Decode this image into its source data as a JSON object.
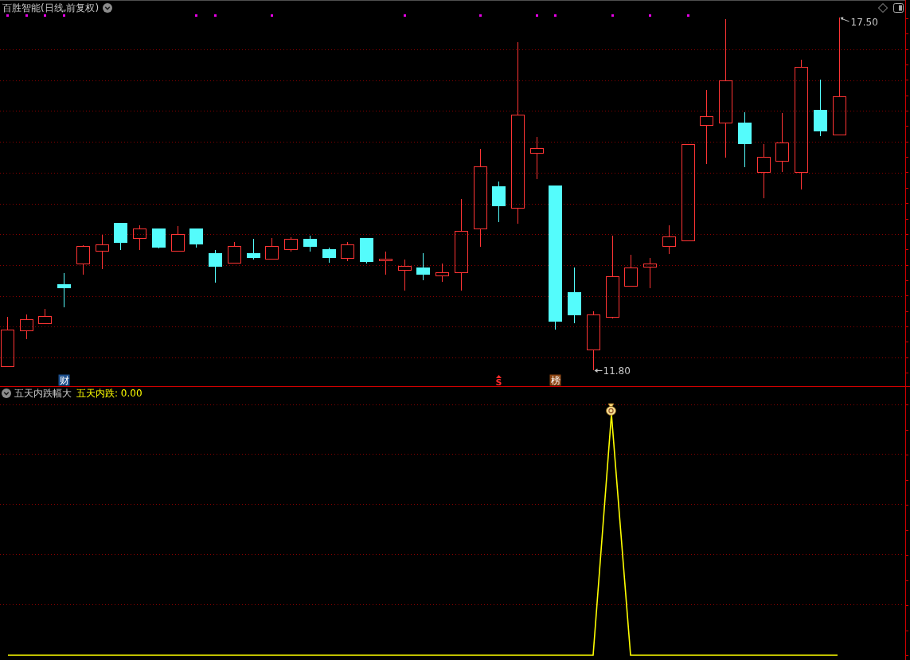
{
  "chart": {
    "title": "百胜智能(日线,前复权)",
    "high_label": "17.50",
    "low_label": "11.80",
    "markers": [
      {
        "kind": "badge",
        "text": "财",
        "color": "#1d4f8c"
      },
      {
        "kind": "signal",
        "text": "S",
        "color": "#ff2a2a"
      },
      {
        "kind": "badge",
        "text": "榜",
        "color": "#8b4513"
      }
    ]
  },
  "indicator": {
    "title": "五天内跌幅大",
    "reading": "五天内跌: 0.00"
  }
}
